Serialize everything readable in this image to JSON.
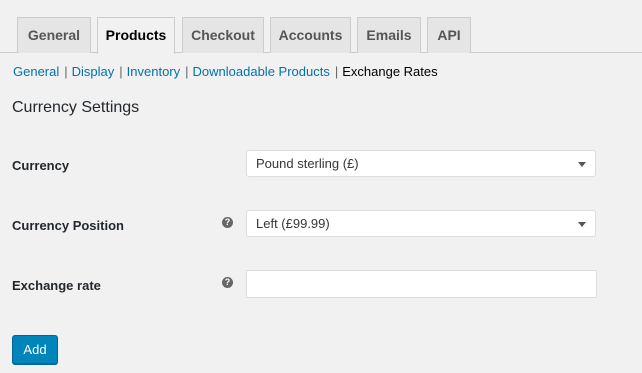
{
  "tabs": [
    {
      "label": "General",
      "active": false
    },
    {
      "label": "Products",
      "active": true
    },
    {
      "label": "Checkout",
      "active": false
    },
    {
      "label": "Accounts",
      "active": false
    },
    {
      "label": "Emails",
      "active": false
    },
    {
      "label": "API",
      "active": false
    }
  ],
  "subnav": {
    "items": [
      "General",
      "Display",
      "Inventory",
      "Downloadable Products"
    ],
    "current": "Exchange Rates",
    "separator": "|"
  },
  "section": {
    "title": "Currency Settings"
  },
  "fields": {
    "currency": {
      "label": "Currency",
      "value": "Pound sterling (£)"
    },
    "currency_position": {
      "label": "Currency Position",
      "value": "Left (£99.99)",
      "help_icon": "?"
    },
    "exchange_rate": {
      "label": "Exchange rate",
      "value": "",
      "help_icon": "?"
    }
  },
  "actions": {
    "add_label": "Add"
  },
  "colors": {
    "accent": "#0085ba",
    "link": "#0073aa",
    "background": "#f1f1f1"
  }
}
